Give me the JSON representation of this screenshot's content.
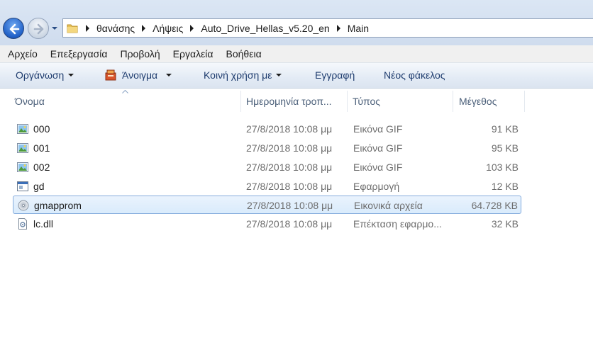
{
  "nav": {
    "back_icon": "back-arrow-icon",
    "forward_icon": "forward-arrow-icon"
  },
  "address": {
    "folder_icon": "folder-icon",
    "crumbs": [
      "θανάσης",
      "Λήψεις",
      "Auto_Drive_Hellas_v5.20_en",
      "Main"
    ]
  },
  "menu": [
    "Αρχείο",
    "Επεξεργασία",
    "Προβολή",
    "Εργαλεία",
    "Βοήθεια"
  ],
  "toolbar": {
    "organize": "Οργάνωση",
    "open": "Άνοιγμα",
    "share": "Κοινή χρήση με",
    "burn": "Εγγραφή",
    "new_folder": "Νέος φάκελος"
  },
  "columns": {
    "name": "Όνομα",
    "date": "Ημερομηνία τροπ...",
    "type": "Τύπος",
    "size": "Μέγεθος"
  },
  "files": [
    {
      "name": "000",
      "date": "27/8/2018 10:08 μμ",
      "type": "Εικόνα GIF",
      "size": "91 KB",
      "icon": "gif-image-icon"
    },
    {
      "name": "001",
      "date": "27/8/2018 10:08 μμ",
      "type": "Εικόνα GIF",
      "size": "95 KB",
      "icon": "gif-image-icon"
    },
    {
      "name": "002",
      "date": "27/8/2018 10:08 μμ",
      "type": "Εικόνα GIF",
      "size": "103 KB",
      "icon": "gif-image-icon"
    },
    {
      "name": "gd",
      "date": "27/8/2018 10:08 μμ",
      "type": "Εφαρμογή",
      "size": "12 KB",
      "icon": "application-icon"
    },
    {
      "name": "gmapprom",
      "date": "27/8/2018 10:08 μμ",
      "type": "Εικονικά αρχεία",
      "size": "64.728 KB",
      "icon": "disc-image-icon",
      "selected": true
    },
    {
      "name": "lc.dll",
      "date": "27/8/2018 10:08 μμ",
      "type": "Επέκταση εφαρμο...",
      "size": "32 KB",
      "icon": "dll-file-icon"
    }
  ]
}
